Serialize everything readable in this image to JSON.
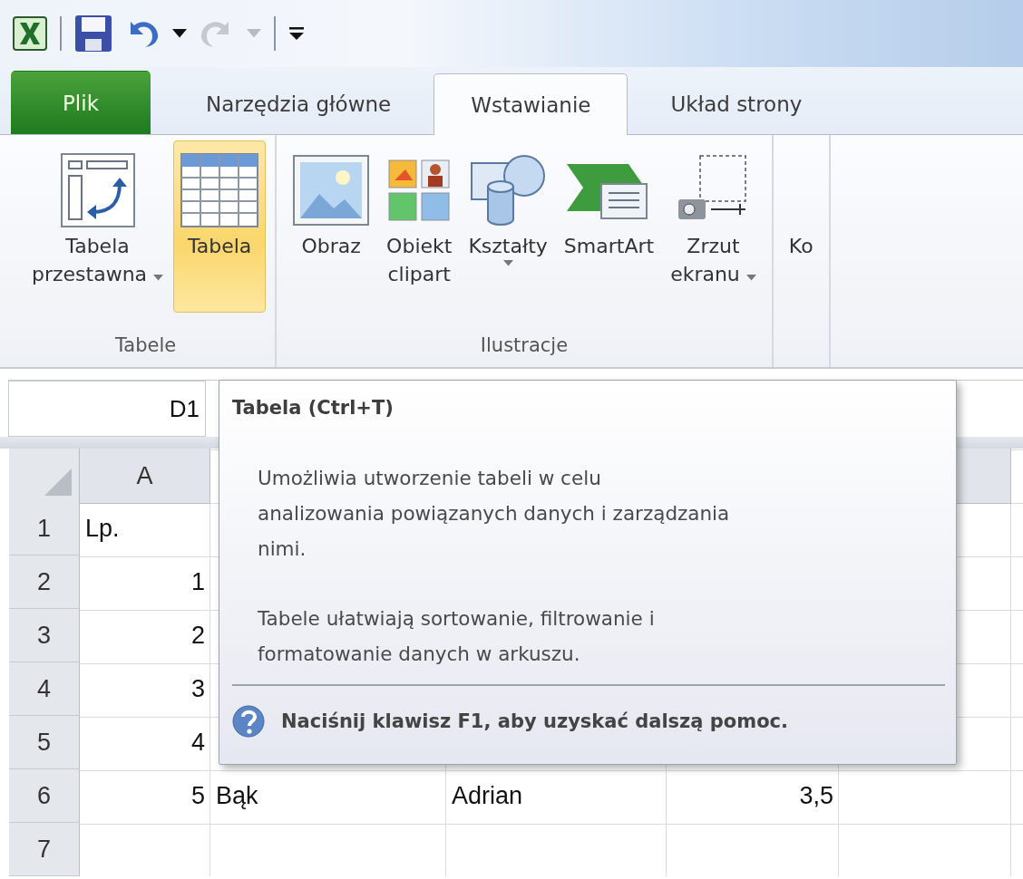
{
  "quick_access": {
    "undo": {
      "disabled": false
    },
    "redo": {
      "disabled": true
    }
  },
  "tabs": [
    {
      "label": "Plik",
      "kind": "file",
      "selected": false
    },
    {
      "label": "Narzędzia główne",
      "kind": "tab",
      "selected": false
    },
    {
      "label": "Wstawianie",
      "kind": "tab",
      "selected": true
    },
    {
      "label": "Układ strony",
      "kind": "tab",
      "selected": false
    }
  ],
  "ribbon": {
    "groups": [
      {
        "label": "Tabele",
        "buttons": [
          {
            "lines": [
              "Tabela",
              "przestawna"
            ],
            "dropdown": true,
            "highlighted": false
          },
          {
            "lines": [
              "Tabela"
            ],
            "dropdown": false,
            "highlighted": true
          }
        ]
      },
      {
        "label": "Ilustracje",
        "buttons": [
          {
            "lines": [
              "Obraz"
            ],
            "dropdown": false,
            "highlighted": false
          },
          {
            "lines": [
              "Obiekt",
              "clipart"
            ],
            "dropdown": false,
            "highlighted": false
          },
          {
            "lines": [
              "Kształty"
            ],
            "dropdown": true,
            "highlighted": false
          },
          {
            "lines": [
              "SmartArt"
            ],
            "dropdown": false,
            "highlighted": false
          },
          {
            "lines": [
              "Zrzut",
              "ekranu"
            ],
            "dropdown": true,
            "highlighted": false
          }
        ]
      },
      {
        "buttons": [
          {
            "lines": [
              "Ko"
            ],
            "dropdown": false,
            "highlighted": false
          }
        ]
      }
    ]
  },
  "name_box": "D1",
  "sheet": {
    "columns": [
      "A"
    ],
    "rows": [
      {
        "header": "1",
        "cells": [
          {
            "text": "Lp.",
            "kind": "text"
          }
        ]
      },
      {
        "header": "2",
        "cells": [
          {
            "text": "1",
            "kind": "number"
          }
        ]
      },
      {
        "header": "3",
        "cells": [
          {
            "text": "2",
            "kind": "number"
          }
        ]
      },
      {
        "header": "4",
        "cells": [
          {
            "text": "3",
            "kind": "number"
          }
        ]
      },
      {
        "header": "5",
        "cells": [
          {
            "text": "4",
            "kind": "number"
          }
        ]
      },
      {
        "header": "6",
        "cells": [
          {
            "text": "5",
            "kind": "number"
          },
          {
            "text": "Bąk",
            "kind": "text"
          },
          {
            "text": "Adrian",
            "kind": "text"
          },
          {
            "text": "3,5",
            "kind": "number"
          }
        ]
      },
      {
        "header": "7"
      }
    ]
  },
  "tooltip": {
    "title": "Tabela (Ctrl+T)",
    "paragraphs": [
      "Umożliwia utworzenie tabeli w celu\nanalizowania powiązanych danych i zarządzania\nnimi.",
      "Tabele ułatwiają sortowanie, filtrowanie i\nformatowanie danych w arkuszu."
    ],
    "help": "Naciśnij klawisz F1, aby uzyskać dalszą pomoc."
  }
}
